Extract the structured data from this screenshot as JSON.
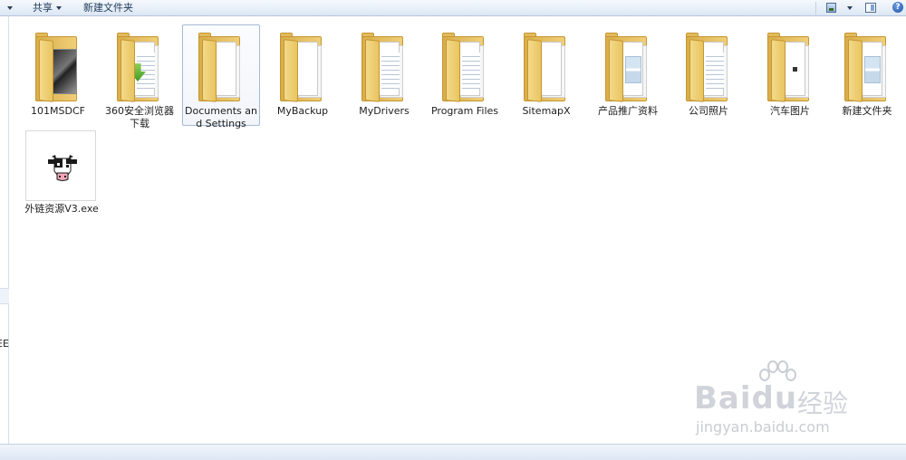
{
  "toolbar": {
    "share_label": "共享",
    "new_folder_label": "新建文件夹",
    "help_label": "?"
  },
  "nav_pane": {
    "clipped_text": "EE"
  },
  "items": [
    {
      "name": "101MSDCF",
      "type": "folder",
      "icon": "photo-folder-icon",
      "selected": false
    },
    {
      "name": "360安全浏览器下载",
      "type": "folder",
      "icon": "download-folder-icon",
      "selected": false
    },
    {
      "name": "Documents and Settings",
      "type": "folder",
      "icon": "document-folder-icon",
      "selected": true
    },
    {
      "name": "MyBackup",
      "type": "folder",
      "icon": "document-folder-icon",
      "selected": false
    },
    {
      "name": "MyDrivers",
      "type": "folder",
      "icon": "document-folder-icon",
      "selected": false
    },
    {
      "name": "Program Files",
      "type": "folder",
      "icon": "document-folder-icon",
      "selected": false
    },
    {
      "name": "SitemapX",
      "type": "folder",
      "icon": "document-folder-icon",
      "selected": false
    },
    {
      "name": "产品推广资料",
      "type": "folder",
      "icon": "image-folder-icon",
      "selected": false
    },
    {
      "name": "公司照片",
      "type": "folder",
      "icon": "document-folder-icon",
      "selected": false
    },
    {
      "name": "汽车图片",
      "type": "folder",
      "icon": "image-folder-icon",
      "selected": false
    },
    {
      "name": "新建文件夹",
      "type": "folder",
      "icon": "image-folder-icon",
      "selected": false
    },
    {
      "name": "外链资源V3.exe",
      "type": "exe",
      "icon": "cow-app-icon",
      "selected": false
    }
  ],
  "watermark": {
    "brand": "Baidu",
    "suffix": "经验",
    "url": "jingyan.baidu.com"
  },
  "colors": {
    "folder": "#e9c560",
    "selection_border": "#a6b9d4",
    "toolbar_text": "#1e395b"
  }
}
